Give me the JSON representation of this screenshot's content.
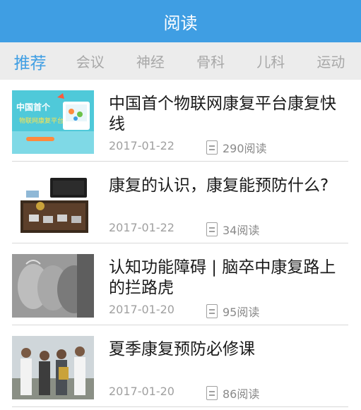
{
  "header": {
    "title": "阅读"
  },
  "tabs": [
    {
      "label": "推荐",
      "active": true
    },
    {
      "label": "会议",
      "active": false
    },
    {
      "label": "神经",
      "active": false
    },
    {
      "label": "骨科",
      "active": false
    },
    {
      "label": "儿科",
      "active": false
    },
    {
      "label": "运动",
      "active": false
    }
  ],
  "articles": [
    {
      "title": "中国首个物联网康复平台康复快线",
      "date": "2017-01-22",
      "reads": "290阅读",
      "thumb_text": "中国首个",
      "thumb_sub": "物联网康复平台"
    },
    {
      "title": "康复的认识，康复能预防什么?",
      "date": "2017-01-22",
      "reads": "34阅读"
    },
    {
      "title": "认知功能障碍 | 脑卒中康复路上的拦路虎",
      "date": "2017-01-20",
      "reads": "95阅读"
    },
    {
      "title": "夏季康复预防必修课",
      "date": "2017-01-20",
      "reads": "86阅读"
    }
  ],
  "colors": {
    "accent": "#3f9ee3",
    "tab_bar": "#ececec"
  },
  "icons": {
    "reads": "document-icon"
  }
}
